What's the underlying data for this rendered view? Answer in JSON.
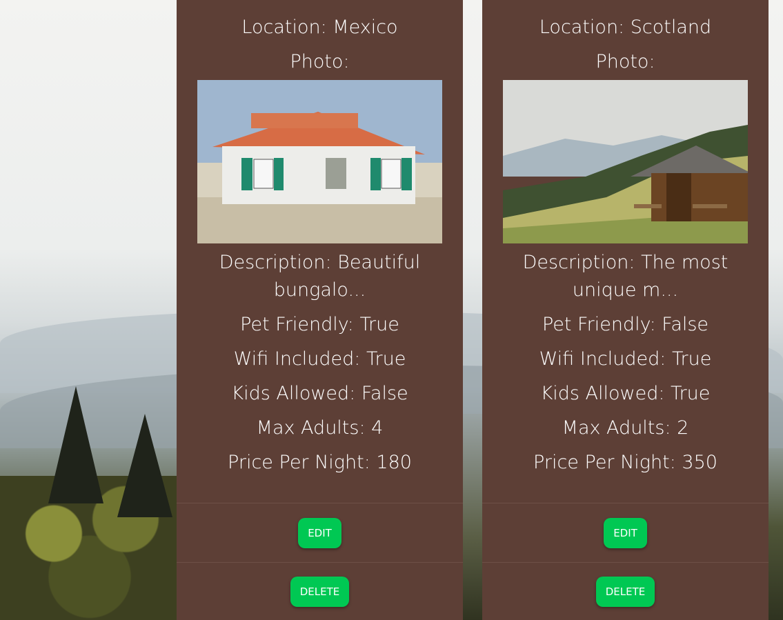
{
  "listings": [
    {
      "location": "Location: Mexico",
      "photo_label": "Photo:",
      "description_line1": "Description: Beautiful",
      "description_line2": "bungalo...",
      "pet_friendly": "Pet Friendly: True",
      "wifi": "Wifi Included: True",
      "kids": "Kids Allowed: False",
      "max_adults": "Max Adults: 4",
      "price": "Price Per Night: 180",
      "edit_label": "EDIT",
      "delete_label": "DELETE"
    },
    {
      "location": "Location: Scotland",
      "photo_label": "Photo:",
      "description_line1": "Description: The most",
      "description_line2": "unique m...",
      "pet_friendly": "Pet Friendly: False",
      "wifi": "Wifi Included: True",
      "kids": "Kids Allowed: True",
      "max_adults": "Max Adults: 2",
      "price": "Price Per Night: 350",
      "edit_label": "EDIT",
      "delete_label": "DELETE"
    }
  ],
  "colors": {
    "card_bg": "#5d3f36",
    "button_bg": "#00c853",
    "text": "#ffffff"
  }
}
